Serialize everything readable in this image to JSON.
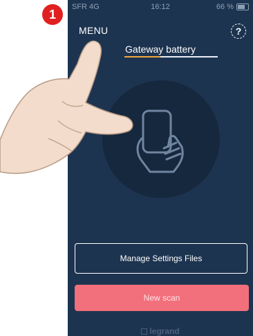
{
  "status_bar": {
    "carrier": "SFR 4G",
    "time": "16:12",
    "battery": "66 %"
  },
  "header": {
    "menu_label": "MENU",
    "help_label": "?",
    "title": "Gateway battery"
  },
  "main": {
    "scan_icon": "phone-in-hand-icon"
  },
  "actions": {
    "manage_label": "Manage Settings Files",
    "scan_label": "New scan"
  },
  "footer": {
    "brand": "legrand"
  },
  "annotation": {
    "step": "1",
    "pointer_icon": "pointing-hand-icon"
  },
  "colors": {
    "background": "#1d3450",
    "accent": "#f0a63a",
    "primary_button": "#f26f7c",
    "badge": "#e02020"
  }
}
